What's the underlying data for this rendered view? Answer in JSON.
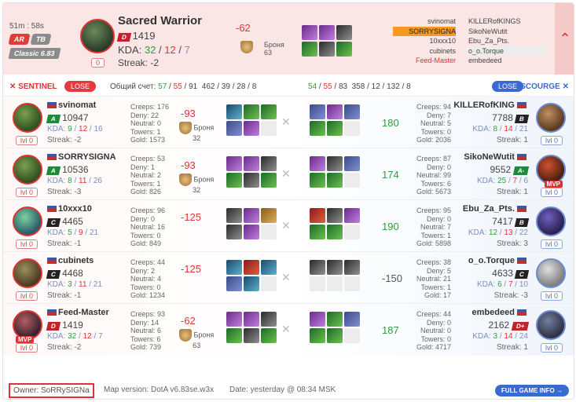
{
  "header": {
    "time": "51m : 58s",
    "mode1": "AR",
    "mode2": "TB",
    "classic": "Classic 6.83",
    "player": "Sacred Warrior",
    "rank": "D",
    "mmr": "1419",
    "kda_label": "KDA:",
    "k": "32",
    "d": "12",
    "a": "7",
    "streak": "Streak: -2",
    "lvl": "0",
    "dmg": "-62",
    "armor_label": "Броня",
    "armor": "63",
    "roster_left": [
      "svinomat",
      "SORRYSIGNA",
      "10xxx10",
      "cubinets",
      "Feed-Master"
    ],
    "roster_right": [
      "KILLERofKINGS",
      "SikoNeWutit",
      "Ebu_Za_Pts.",
      "o_o.Torque",
      "embedeed"
    ]
  },
  "teams": {
    "sentinel": "SENTINEL",
    "scourge": "SCOURGE",
    "lose": "LOSE",
    "total_label": "Общий счет:",
    "left_k": "57",
    "left_d": "55",
    "left_a": "91",
    "left_rest": "462 / 39 / 28 / 8",
    "right_k": "54",
    "right_d": "55",
    "right_a": "83",
    "right_rest": "358 / 12 / 132 / 8"
  },
  "rows": [
    {
      "l_name": "svinomat",
      "l_rank": "A",
      "l_mmr": "10947",
      "l_k": "9",
      "l_d": "12",
      "l_a": "16",
      "l_streak": "Streak: -2",
      "l_lvl": "lvl 0",
      "l_stats": [
        "Creeps: 176",
        "Deny: 22",
        "Neutral: 0",
        "Towers: 1",
        "Gold: 1573"
      ],
      "l_dmg": "-93",
      "armor": "32",
      "r_dmg": "180",
      "r_stats": [
        "Creeps: 94",
        "Deny: 7",
        "Neutral: 5",
        "Towers: 0",
        "Gold: 2036"
      ],
      "r_name": "KILLERofKING",
      "r_rank": "B",
      "r_mmr": "7788",
      "r_k": "8",
      "r_d": "14",
      "r_a": "21",
      "r_streak": "Streak: 1",
      "r_lvl": "lvl 0"
    },
    {
      "l_name": "SORRYSIGNA",
      "l_rank": "A",
      "l_mmr": "10536",
      "l_k": "8",
      "l_d": "11",
      "l_a": "26",
      "l_streak": "Streak: -3",
      "l_lvl": "lvl 0",
      "l_stats": [
        "Creeps: 53",
        "Deny: 1",
        "Neutral: 2",
        "Towers: 1",
        "Gold: 826"
      ],
      "l_dmg": "-93",
      "armor": "32",
      "r_dmg": "174",
      "r_stats": [
        "Creeps: 87",
        "Deny: 0",
        "Neutral: 99",
        "Towers: 6",
        "Gold: 5673"
      ],
      "r_name": "SikoNeWutit",
      "r_rank": "A-",
      "r_mmr": "9552",
      "r_k": "25",
      "r_d": "7",
      "r_a": "6",
      "r_streak": "Streak: 1",
      "r_lvl": "lvl 0",
      "r_mvp": "MVP"
    },
    {
      "l_name": "10xxx10",
      "l_rank": "C",
      "l_mmr": "4465",
      "l_k": "5",
      "l_d": "9",
      "l_a": "21",
      "l_streak": "Streak: -1",
      "l_lvl": "lvl 0",
      "l_stats": [
        "Creeps: 96",
        "Deny: 0",
        "Neutral: 16",
        "Towers: 0",
        "Gold: 849"
      ],
      "l_dmg": "-125",
      "armor": "",
      "r_dmg": "190",
      "r_stats": [
        "Creeps: 95",
        "Deny: 0",
        "Neutral: 7",
        "Towers: 1",
        "Gold: 5898"
      ],
      "r_name": "Ebu_Za_Pts.",
      "r_rank": "B",
      "r_mmr": "7417",
      "r_k": "12",
      "r_d": "13",
      "r_a": "22",
      "r_streak": "Streak: 3",
      "r_lvl": "lvl 0"
    },
    {
      "l_name": "cubinets",
      "l_rank": "C",
      "l_mmr": "4468",
      "l_k": "3",
      "l_d": "11",
      "l_a": "21",
      "l_streak": "Streak: -1",
      "l_lvl": "lvl 0",
      "l_stats": [
        "Creeps: 44",
        "Deny: 2",
        "Neutral: 4",
        "Towers: 0",
        "Gold: 1234"
      ],
      "l_dmg": "-125",
      "armor": "",
      "r_dmg": "-150",
      "r_stats": [
        "Creeps: 38",
        "Deny: 5",
        "Neutral: 21",
        "Towers: 1",
        "Gold: 17"
      ],
      "r_name": "o_o.Torque",
      "r_rank": "C",
      "r_mmr": "4633",
      "r_k": "6",
      "r_d": "7",
      "r_a": "10",
      "r_streak": "Streak: -3",
      "r_lvl": "lvl 0"
    },
    {
      "l_name": "Feed-Master",
      "l_rank": "D",
      "l_mmr": "1419",
      "l_k": "32",
      "l_d": "12",
      "l_a": "7",
      "l_streak": "Streak: -2",
      "l_lvl": "lvl 0",
      "l_mvp": "MVP",
      "l_stats": [
        "Creeps: 93",
        "Deny: 14",
        "Neutral: 6",
        "Towers: 6",
        "Gold: 739"
      ],
      "l_dmg": "-62",
      "armor": "63",
      "r_dmg": "187",
      "r_stats": [
        "Creeps: 44",
        "Deny: 0",
        "Neutral: 0",
        "Towers: 0",
        "Gold: 4717"
      ],
      "r_name": "embedeed",
      "r_rank": "D+",
      "r_mmr": "2162",
      "r_k": "3",
      "r_d": "14",
      "r_a": "24",
      "r_streak": "Streak: 1",
      "r_lvl": "lvl 0"
    }
  ],
  "footer": {
    "owner": "Owner: SoRRySIGNa",
    "map": "Map version: DotA v6.83se.w3x",
    "date": "Date: yesterday @ 08:34 MSK",
    "full": "FULL GAME INFO →"
  }
}
